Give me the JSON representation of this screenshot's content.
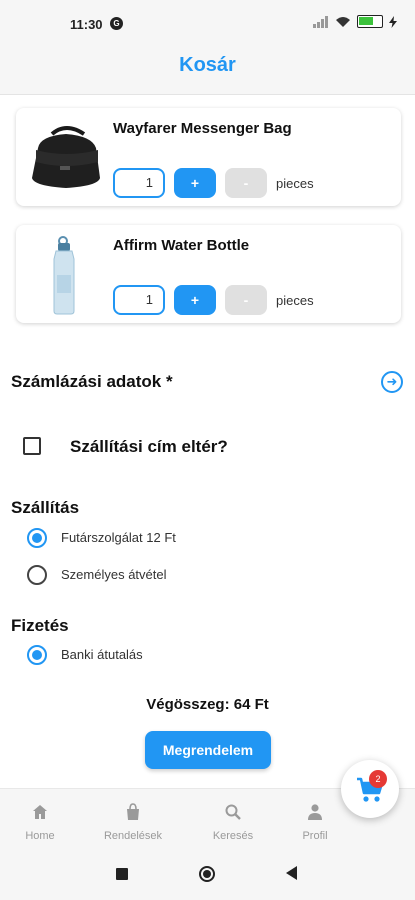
{
  "status_bar": {
    "time": "11:30",
    "notification_glyph": "G"
  },
  "header": {
    "title": "Kosár"
  },
  "cart": {
    "items": [
      {
        "name": "Wayfarer Messenger Bag",
        "quantity": "1",
        "plus_label": "+",
        "minus_label": "-",
        "unit_label": "pieces"
      },
      {
        "name": "Affirm Water Bottle",
        "quantity": "1",
        "plus_label": "+",
        "minus_label": "-",
        "unit_label": "pieces"
      }
    ]
  },
  "billing": {
    "title": "Számlázási adatok *"
  },
  "shipping_address": {
    "label": "Szállítási cím eltér?",
    "checked": false
  },
  "shipping": {
    "title": "Szállítás",
    "options": [
      {
        "label": "Futárszolgálat 12 Ft",
        "selected": true
      },
      {
        "label": "Személyes átvétel",
        "selected": false
      }
    ]
  },
  "payment": {
    "title": "Fizetés",
    "options": [
      {
        "label": "Banki átutalás",
        "selected": true
      }
    ]
  },
  "total": {
    "text": "Végösszeg: 64 Ft"
  },
  "order_button": {
    "label": "Megrendelem"
  },
  "bottom_nav": {
    "items": [
      {
        "label": "Home",
        "icon": "home-icon"
      },
      {
        "label": "Rendelések",
        "icon": "bag-icon"
      },
      {
        "label": "Keresés",
        "icon": "search-icon"
      },
      {
        "label": "Profil",
        "icon": "person-icon"
      }
    ]
  },
  "cart_fab": {
    "badge": "2",
    "icon": "cart-icon"
  },
  "colors": {
    "accent": "#2196f3",
    "badge": "#e53935",
    "disabled": "#e0e0e0"
  }
}
